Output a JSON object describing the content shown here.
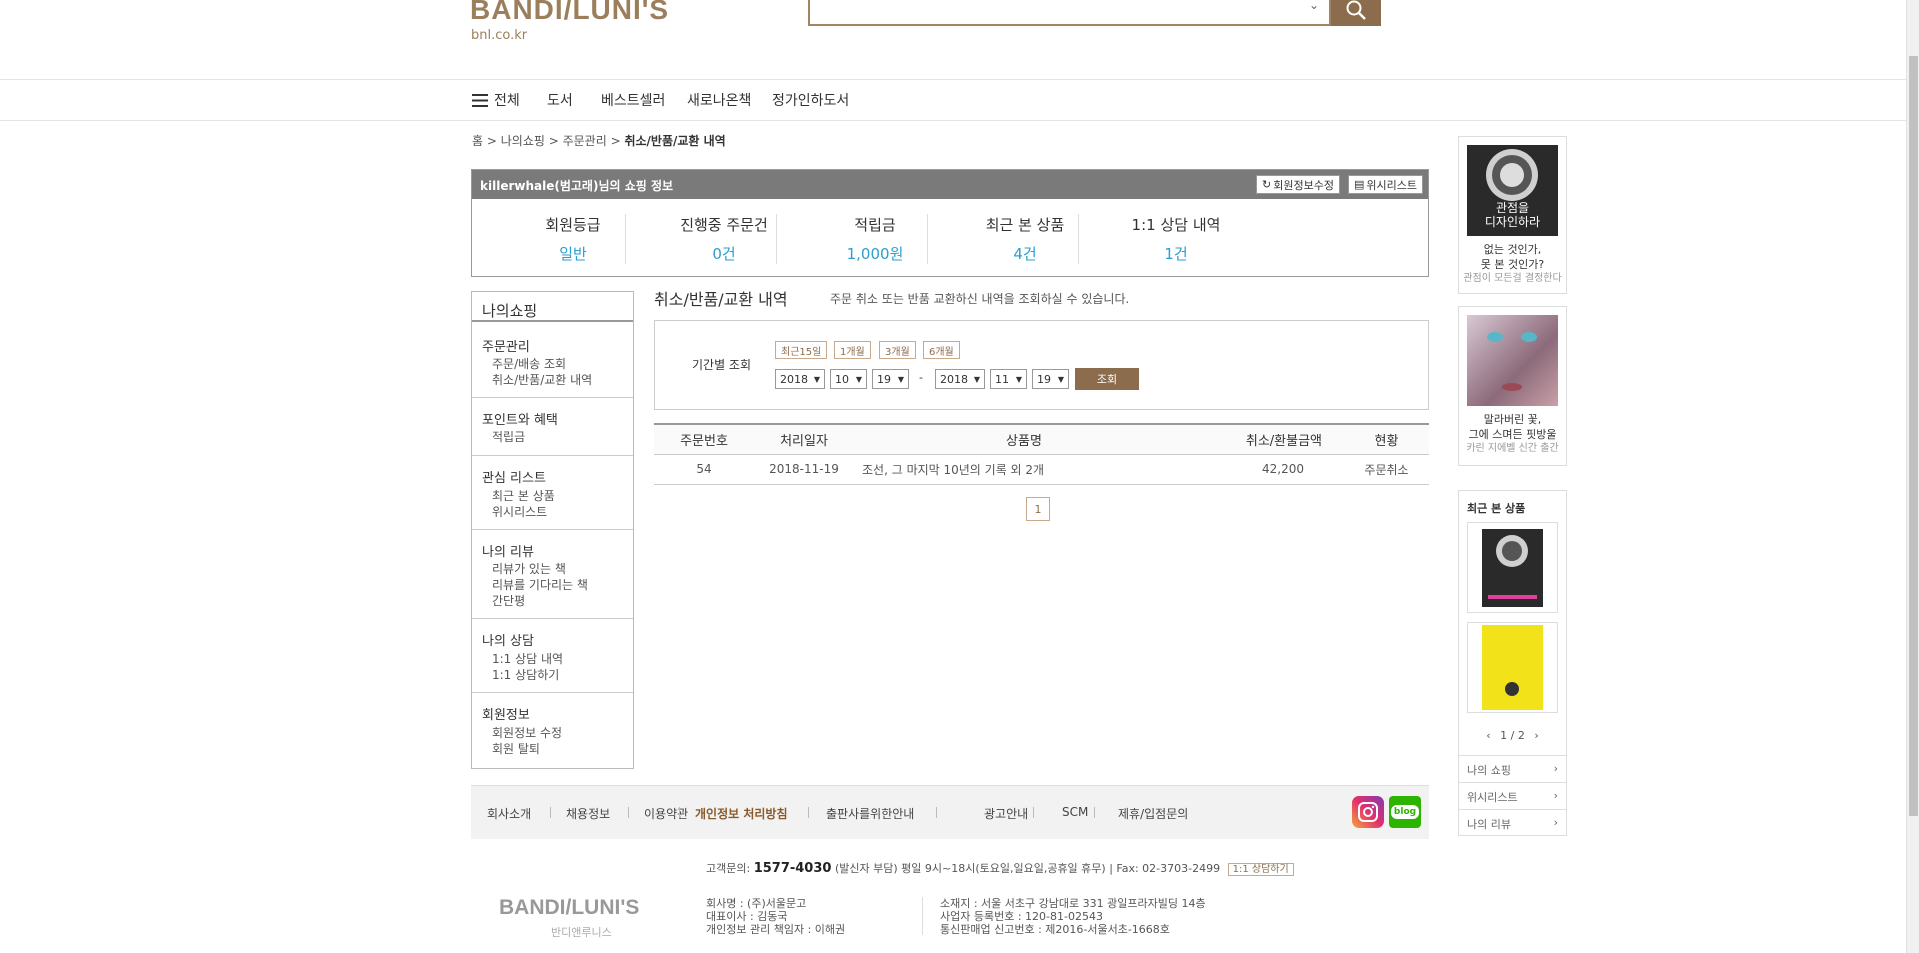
{
  "header": {
    "logo": "BANDI/LUNI'S",
    "domain": "bnl.co.kr",
    "search_placeholder": ""
  },
  "nav": {
    "all": "전체",
    "items": [
      "도서",
      "베스트셀러",
      "새로나온책",
      "정가인하도서"
    ]
  },
  "breadcrumb": {
    "items": [
      "홈",
      "나의쇼핑",
      "주문관리"
    ],
    "current": "취소/반품/교환 내역"
  },
  "member": {
    "title": "killerwhale(범고래)님의 쇼핑 정보",
    "edit_btn": "회원정보수정",
    "wish_btn": "위시리스트",
    "stats": [
      {
        "label": "회원등급",
        "value": "일반"
      },
      {
        "label": "진행중 주문건",
        "value": "0건"
      },
      {
        "label": "적립금",
        "value": "1,000원"
      },
      {
        "label": "최근 본 상품",
        "value": "4건"
      },
      {
        "label": "1:1 상담 내역",
        "value": "1건"
      }
    ]
  },
  "sidebar": {
    "title": "나의쇼핑",
    "groups": [
      {
        "title": "주문관리",
        "links": [
          "주문/배송 조회",
          "취소/반품/교환 내역"
        ]
      },
      {
        "title": "포인트와 혜택",
        "links": [
          "적립금"
        ]
      },
      {
        "title": "관심 리스트",
        "links": [
          "최근 본 상품",
          "위시리스트"
        ]
      },
      {
        "title": "나의 리뷰",
        "links": [
          "리뷰가 있는 책",
          "리뷰를 기다리는 책",
          "간단평"
        ]
      },
      {
        "title": "나의 상담",
        "links": [
          "1:1 상담 내역",
          "1:1 상담하기"
        ]
      },
      {
        "title": "회원정보",
        "links": [
          "회원정보 수정",
          "회원 탈퇴"
        ]
      }
    ]
  },
  "main": {
    "title": "취소/반품/교환 내역",
    "desc": "주문 취소 또는 반품 교환하신 내역을 조회하실 수 있습니다.",
    "period_label": "기간별 조회",
    "period_buttons": [
      "최근15일",
      "1개월",
      "3개월",
      "6개월"
    ],
    "from": {
      "year": "2018",
      "month": "10",
      "day": "19"
    },
    "to": {
      "year": "2018",
      "month": "11",
      "day": "19"
    },
    "dash": "-",
    "search_btn": "조회",
    "table": {
      "headers": [
        "주문번호",
        "처리일자",
        "상품명",
        "취소/환불금액",
        "현황"
      ],
      "rows": [
        [
          "54",
          "2018-11-19",
          "조선, 그 마지막 10년의 기록 외 2개",
          "42,200",
          "주문취소"
        ]
      ]
    },
    "page": "1"
  },
  "right": {
    "ad1": {
      "line1": "없는 것인가,",
      "line2": "못 본 것인가?",
      "line3": "관점이 모든걸 결정한다",
      "cover": "관점을\n디자인하라"
    },
    "ad2": {
      "line1": "말라버린 꽃,",
      "line2": "그에 스며든 핏방울",
      "line3": "카린 지에벨 신간 출간"
    },
    "recent_title": "최근 본 상품",
    "recent_pager": "1 / 2",
    "links": [
      "나의 쇼핑",
      "위시리스트",
      "나의 리뷰"
    ]
  },
  "footer": {
    "links": [
      "회사소개",
      "채용정보",
      "이용약관",
      "개인정보 처리방침",
      "출판사를위한안내",
      "광고안내",
      "SCM",
      "제휴/입점문의"
    ],
    "cs_label": "고객문의:",
    "cs_phone": "1577-4030",
    "cs_rest": "(발신자 부담) 평일 9시~18시(토요일,일요일,공휴일 휴무) | Fax: 02-3703-2499",
    "cs_btn": "1:1 상담하기",
    "logo": "BANDI/LUNI'S",
    "logo_sub": "반디앤루니스",
    "company": [
      "회사명 : (주)서울문고",
      "대표이사 : 김동국",
      "개인정보 관리 책임자 : 이해권"
    ],
    "address": [
      "소재지 : 서울 서초구 강남대로 331 광일프라자빌딩 14층",
      "사업자 등록번호 : 120-81-02543",
      "통신판매업 신고번호 : 제2016-서울서초-1668호"
    ]
  },
  "colors": {
    "brand": "#8b6d4d",
    "accent_blue": "#2a9fd0"
  }
}
